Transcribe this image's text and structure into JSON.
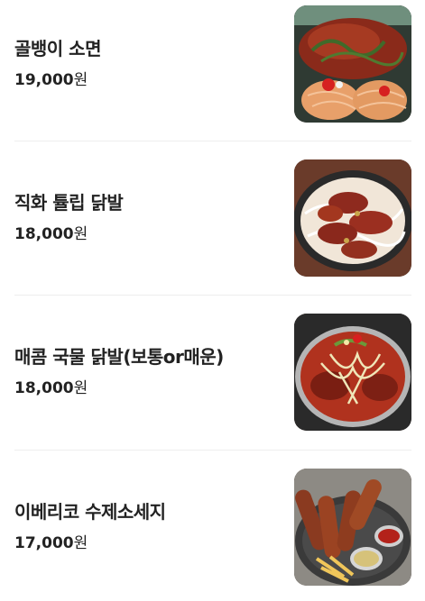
{
  "menu": {
    "items": [
      {
        "name": "골뱅이 소면",
        "price": "19,000",
        "currency": "원",
        "image_icon": "food-photo-golbaengi-somyeon"
      },
      {
        "name": "직화 튤립 닭발",
        "price": "18,000",
        "currency": "원",
        "image_icon": "food-photo-tulip-dakbal"
      },
      {
        "name": "매콤 국물 닭발(보통or매운)",
        "price": "18,000",
        "currency": "원",
        "image_icon": "food-photo-soup-dakbal"
      },
      {
        "name": "이베리코 수제소세지",
        "price": "17,000",
        "currency": "원",
        "image_icon": "food-photo-iberico-sausage"
      }
    ]
  },
  "colors": {
    "text": "#222222",
    "divider": "#eeeeee",
    "background": "#ffffff"
  }
}
